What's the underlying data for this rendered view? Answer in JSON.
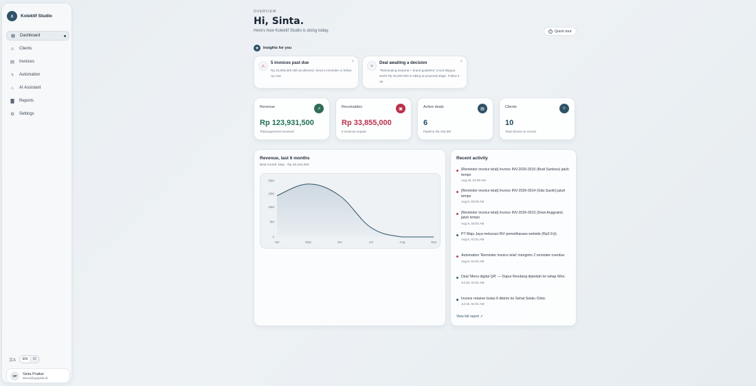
{
  "sidebar": {
    "brand_name": "Kolektif Studio",
    "brand_logo_glyph": "∧",
    "items": [
      {
        "label": "Dashboard",
        "icon": "grid-icon",
        "glyph": "▦",
        "active": true
      },
      {
        "label": "Clients",
        "icon": "users-icon",
        "glyph": "☺"
      },
      {
        "label": "Invoices",
        "icon": "file-icon",
        "glyph": "▤"
      },
      {
        "label": "Automation",
        "icon": "bolt-icon",
        "glyph": "ϟ"
      },
      {
        "label": "AI Assistant",
        "icon": "bot-icon",
        "glyph": "⌂"
      },
      {
        "label": "Reports",
        "icon": "bar-chart-icon",
        "glyph": "▇"
      },
      {
        "label": "Settings",
        "icon": "gear-icon",
        "glyph": "⚙"
      }
    ],
    "language": {
      "options": [
        "EN",
        "ID"
      ],
      "selected": "EN",
      "icon_glyph": "文A"
    },
    "user": {
      "initials": "SP",
      "name": "Sinta Pratiwi",
      "email": "demo@opspilot.id"
    }
  },
  "header": {
    "eyebrow": "OVERVIEW",
    "greeting": "Hi, Sinta.",
    "subtitle": "Here's how Kolektif Studio is doing today.",
    "tour_label": "Quick tour",
    "tour_glyph": "?"
  },
  "insights": {
    "heading": "Insights for you",
    "heading_glyph": "✦",
    "cards": [
      {
        "title": "5 invoices past due",
        "body": "Rp 33,855,000 still uncollected. Send a reminder or follow up now.",
        "glyph": "⚠",
        "color": "#c0394b"
      },
      {
        "title": "Deal awaiting a decision",
        "body": "\"Rebranding korporat + brand guideline\" (Andi Wijaya) worth Rp 45,000,000 is sitting at proposal stage. Follow it up.",
        "glyph": "✧",
        "color": "#2e5266"
      }
    ],
    "close_glyph": "×"
  },
  "stats": [
    {
      "label": "Revenue",
      "value": "Rp 123,931,500",
      "note": "Total payments received",
      "icon": "trend-up-icon",
      "glyph": "↗",
      "icon_color": "#2f6e56",
      "value_color": "#1f6f55"
    },
    {
      "label": "Receivables",
      "value": "Rp 33,855,000",
      "note": "5 invoices unpaid",
      "icon": "receipt-icon",
      "glyph": "▣",
      "icon_color": "#b8314a",
      "value_color": "#b8314a"
    },
    {
      "label": "Active deals",
      "value": "6",
      "note": "Pipeline Rp 184.5M",
      "icon": "document-icon",
      "glyph": "▤",
      "icon_color": "#2e5266",
      "value_color": "#1f4a5e"
    },
    {
      "label": "Clients",
      "value": "10",
      "note": "Total clients on record",
      "icon": "users-icon",
      "glyph": "☺",
      "icon_color": "#2e5266",
      "value_color": "#1f4a5e"
    }
  ],
  "chart": {
    "title": "Revenue, last 6 months",
    "subtitle": "Best month: May · Rp 28,194,000"
  },
  "chart_data": {
    "type": "area",
    "title": "Revenue, last 6 months",
    "categories": [
      "Apr",
      "May",
      "Jun",
      "Jul",
      "Aug",
      "Sep"
    ],
    "values": [
      22,
      28.194,
      22,
      5,
      0,
      0
    ],
    "y_ticks": [
      "0",
      "8M",
      "16M",
      "23M",
      "30M"
    ],
    "y_tick_values": [
      0,
      8,
      16,
      23,
      30
    ],
    "ylim": [
      0,
      30
    ],
    "grid": false,
    "line_color": "#2e5266",
    "fill_color": "#cbd6df"
  },
  "activity": {
    "title": "Recent activity",
    "items": [
      {
        "text": "[Reminder invoice telat] Invoice INV-2026-0015 (Budi Santoso) jatuh tempo",
        "time": "Aug 25, 01:00 AM",
        "color": "#c0394b"
      },
      {
        "text": "[Reminder invoice telat] Invoice INV-2026-0014 (Gita Savitri) jatuh tempo",
        "time": "Aug 9, 03:03 AM",
        "color": "#c0394b"
      },
      {
        "text": "[Reminder invoice telat] Invoice INV-2026-0013 (Dewi Anggraini) jatuh tempo",
        "time": "Aug 9, 03:03 AM",
        "color": "#c0394b"
      },
      {
        "text": "PT Maju Jaya melunasi INV pemeliharaan website (Rp3.9 jt).",
        "time": "Aug 8, 01:01 AM",
        "color": "#2f6e56"
      },
      {
        "text": "Automation 'Reminder invoice telat' mengirim 2 reminder overdue.",
        "time": "Aug 8, 01:01 AM",
        "color": "#c0394b"
      },
      {
        "text": "Deal 'Menu digital QR' — Dapur Rendang dipindah ke tahap Won.",
        "time": "Jul 20, 01:01 AM",
        "color": "#2f6e56"
      },
      {
        "text": "Invoice retainer bulan 6 dikirim ke Sehat Selalu Clinic.",
        "time": "Jul 15, 01:01 AM",
        "color": "#2e5266"
      }
    ],
    "link_label": "View full report ↗"
  }
}
